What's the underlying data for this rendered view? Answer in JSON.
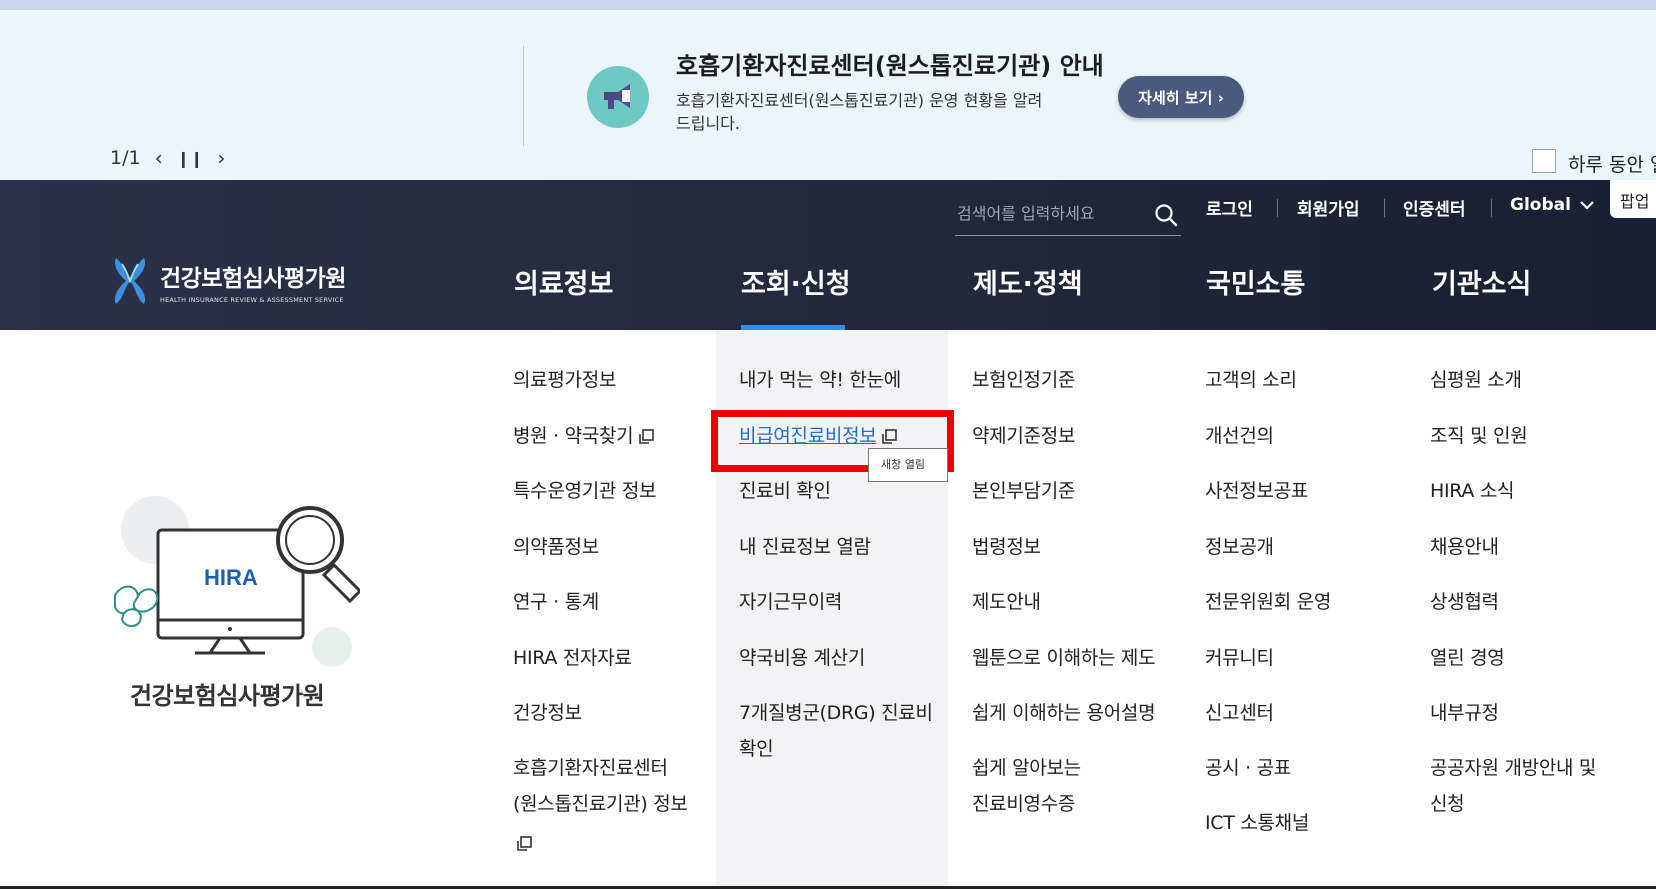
{
  "banner": {
    "pager": "1/1",
    "title": "호흡기환자진료센터(원스톱진료기관) 안내",
    "description": "호흡기환자진료센터(원스톱진료기관) 운영 현황을 알려드립니다.",
    "more_label": "자세히 보기 ›",
    "today_close_label": "하루 동안 열",
    "icon": "megaphone-icon",
    "colors": {
      "background": "#eaf6fb",
      "icon_circle": "#6ec9c5",
      "button": "#4a5a7e"
    }
  },
  "header": {
    "search_placeholder": "검색어를 입력하세요",
    "util_links": {
      "login": "로그인",
      "signup": "회원가입",
      "cert": "인증센터",
      "global": "Global"
    },
    "popup_tab": "팝업",
    "logo": {
      "korean": "건강보험심사평가원",
      "english": "HEALTH INSURANCE REVIEW & ASSESSMENT SERVICE"
    },
    "gnb": {
      "medical_info": "의료정보",
      "inquiry": "조회·신청",
      "policy": "제도·정책",
      "communication": "국민소통",
      "agency": "기관소식"
    },
    "colors": {
      "background": "#1f2538",
      "active_underline": "#2f8ce8"
    }
  },
  "illustration": {
    "screen_text": "HIRA",
    "title": "건강보험심사평가원"
  },
  "menu": {
    "medical_info": [
      "의료평가정보",
      "병원 · 약국찾기",
      "특수운영기관 정보",
      "의약품정보",
      "연구 · 통계",
      "HIRA 전자자료",
      "건강정보",
      "호흡기환자진료센터",
      "(원스톱진료기관) 정보"
    ],
    "inquiry": [
      "내가 먹는 약! 한눈에",
      "비급여진료비정보",
      "진료비 확인",
      "내 진료정보 열람",
      "자기근무이력",
      "약국비용 계산기",
      "7개질병군(DRG) 진료비",
      "확인"
    ],
    "policy": [
      "보험인정기준",
      "약제기준정보",
      "본인부담기준",
      "법령정보",
      "제도안내",
      "웹툰으로 이해하는 제도",
      "쉽게 이해하는 용어설명",
      "쉽게 알아보는",
      "진료비영수증"
    ],
    "communication": [
      "고객의 소리",
      "개선건의",
      "사전정보공표",
      "정보공개",
      "전문위원회 운영",
      "커뮤니티",
      "신고센터",
      "공시 · 공표",
      "ICT 소통채널"
    ],
    "agency": [
      "심평원 소개",
      "조직 및 인원",
      "HIRA 소식",
      "채용안내",
      "상생협력",
      "열린 경영",
      "내부규정",
      "공공자원 개방안내 및",
      "신청"
    ],
    "tooltip": "새창 열림",
    "colors": {
      "active_column": "#f3f3f5",
      "highlight_link": "#1e6ed0",
      "annotation_box": "#ee0000"
    }
  }
}
